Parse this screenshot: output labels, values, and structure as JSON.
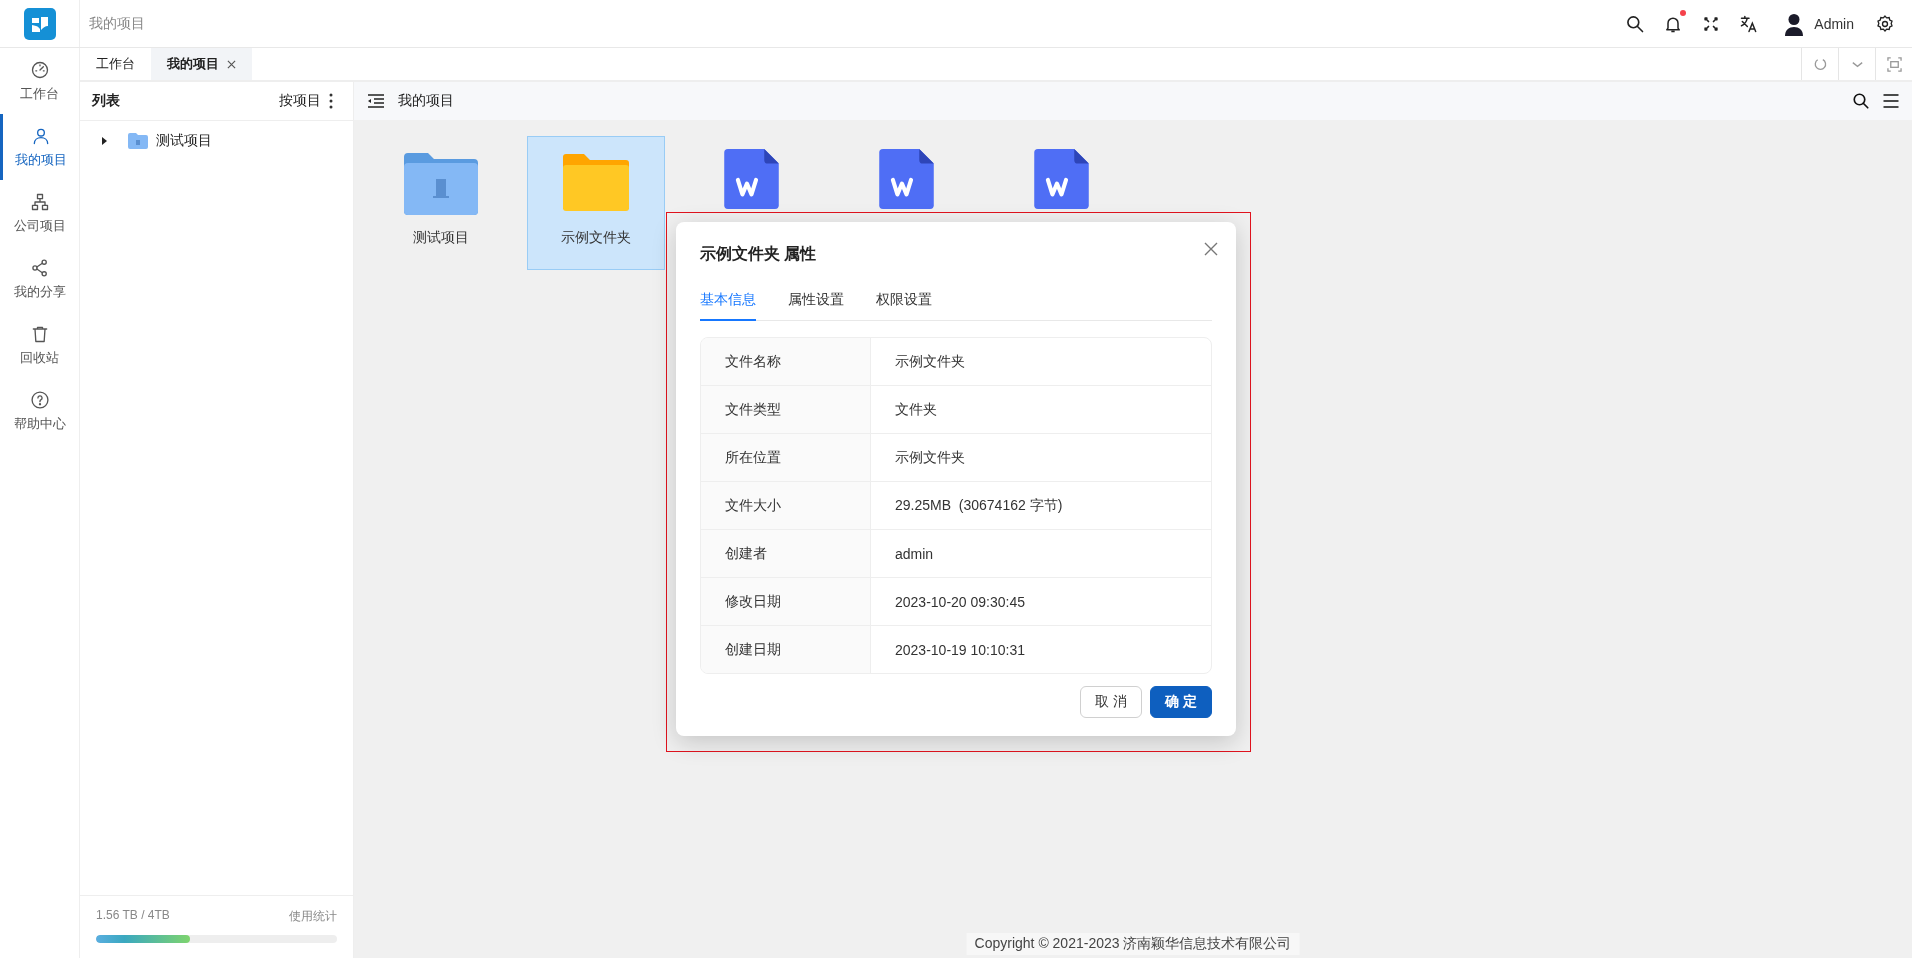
{
  "header": {
    "breadcrumb": "我的项目",
    "user": "Admin",
    "has_notification": true
  },
  "nav": [
    {
      "kind": "dashboard",
      "label": "工作台",
      "selected": false
    },
    {
      "kind": "user",
      "label": "我的项目",
      "selected": true
    },
    {
      "kind": "org",
      "label": "公司项目",
      "selected": false
    },
    {
      "kind": "share",
      "label": "我的分享",
      "selected": false
    },
    {
      "kind": "trash",
      "label": "回收站",
      "selected": false
    },
    {
      "kind": "help",
      "label": "帮助中心",
      "selected": false
    }
  ],
  "tabs": [
    {
      "label": "工作台",
      "selected": false,
      "closable": false
    },
    {
      "label": "我的项目",
      "selected": true,
      "closable": true
    }
  ],
  "list_panel": {
    "title": "列表",
    "sort_label": "按项目",
    "tree": [
      {
        "label": "测试项目",
        "expanded": false
      }
    ],
    "storage": {
      "usage": "1.56 TB / 4TB",
      "stats_link": "使用统计",
      "level": 0.39
    }
  },
  "content": {
    "title": "我的项目",
    "items": [
      {
        "kind": "project",
        "label": "测试项目",
        "selected": false
      },
      {
        "kind": "folder",
        "label": "示例文件夹",
        "selected": true
      },
      {
        "kind": "word",
        "selected": false
      },
      {
        "kind": "word",
        "selected": false
      },
      {
        "kind": "word",
        "selected": false
      }
    ]
  },
  "dialog": {
    "title": "示例文件夹 属性",
    "tabs": [
      {
        "label": "基本信息",
        "selected": true
      },
      {
        "label": "属性设置",
        "selected": false
      },
      {
        "label": "权限设置",
        "selected": false
      }
    ],
    "rows": [
      {
        "label": "文件名称",
        "value": "示例文件夹"
      },
      {
        "label": "文件类型",
        "value": "文件夹"
      },
      {
        "label": "所在位置",
        "value": "示例文件夹"
      },
      {
        "label": "文件大小",
        "value": "29.25MB  (30674162 字节)"
      },
      {
        "label": "创建者",
        "value": "admin"
      },
      {
        "label": "修改日期",
        "value": "2023-10-20 09:30:45"
      },
      {
        "label": "创建日期",
        "value": "2023-10-19 10:10:31"
      }
    ],
    "buttons": [
      {
        "label": "取 消",
        "kind": "default"
      },
      {
        "label": "确 定",
        "kind": "primary"
      }
    ]
  },
  "footer": {
    "copyright": "Copyright © 2021-2023 济南颖华信息技术有限公司"
  }
}
